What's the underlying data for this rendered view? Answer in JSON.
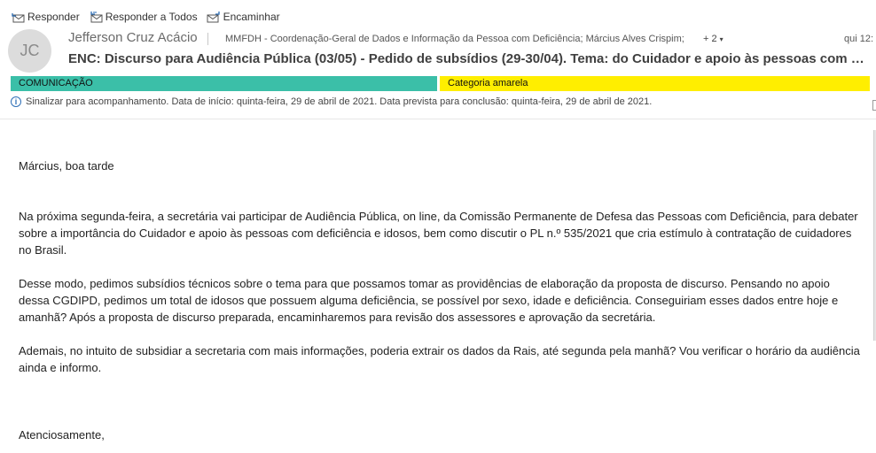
{
  "toolbar": {
    "reply": "Responder",
    "reply_all": "Responder a Todos",
    "forward": "Encaminhar"
  },
  "message": {
    "avatar_initials": "JC",
    "sender": "Jefferson Cruz Acácio",
    "recipients": "MMFDH - Coordenação-Geral de Dados e Informação da Pessoa com Deficiência; Március Alves Crispim;",
    "more_recipients": "+ 2",
    "date": "qui 12:",
    "subject": "ENC: Discurso para Audiência Pública (03/05) - Pedido de subsídios (29-30/04). Tema: do Cuidador e apoio às pessoas com deficiência e idosos"
  },
  "categories": [
    {
      "label": "COMUNICAÇÃO",
      "color": "#3bbfa8"
    },
    {
      "label": "Categoria amarela",
      "color": "#ffee00"
    }
  ],
  "flag": "Sinalizar para acompanhamento.  Data de início: quinta-feira, 29 de abril de 2021.  Data prevista para conclusão: quinta-feira, 29 de abril de 2021.",
  "body": {
    "greeting": "Március, boa tarde",
    "p1": "Na próxima segunda-feira, a secretária vai participar de Audiência Pública, on line, da Comissão Permanente de Defesa das Pessoas com Deficiência, para debater sobre a importância do Cuidador e apoio às pessoas com deficiência e idosos, bem como discutir o PL n.º 535/2021 que cria estímulo à contratação de cuidadores no Brasil.",
    "p2": "Desse modo, pedimos subsídios técnicos sobre o tema para que possamos tomar as providências de elaboração da proposta de discurso. Pensando no apoio dessa CGDIPD, pedimos um total de idosos que possuem alguma deficiência, se possível por sexo, idade e deficiência. Conseguiriam esses dados entre hoje e amanhã? Após a proposta de discurso preparada, encaminharemos para revisão dos assessores e aprovação da secretária.",
    "p3": "Ademais, no intuito de subsidiar a secretaria com mais informações, poderia extrair os dados da Rais, até segunda pela manhã? Vou verificar o horário da audiência ainda e informo.",
    "closing": "Atenciosamente,"
  }
}
